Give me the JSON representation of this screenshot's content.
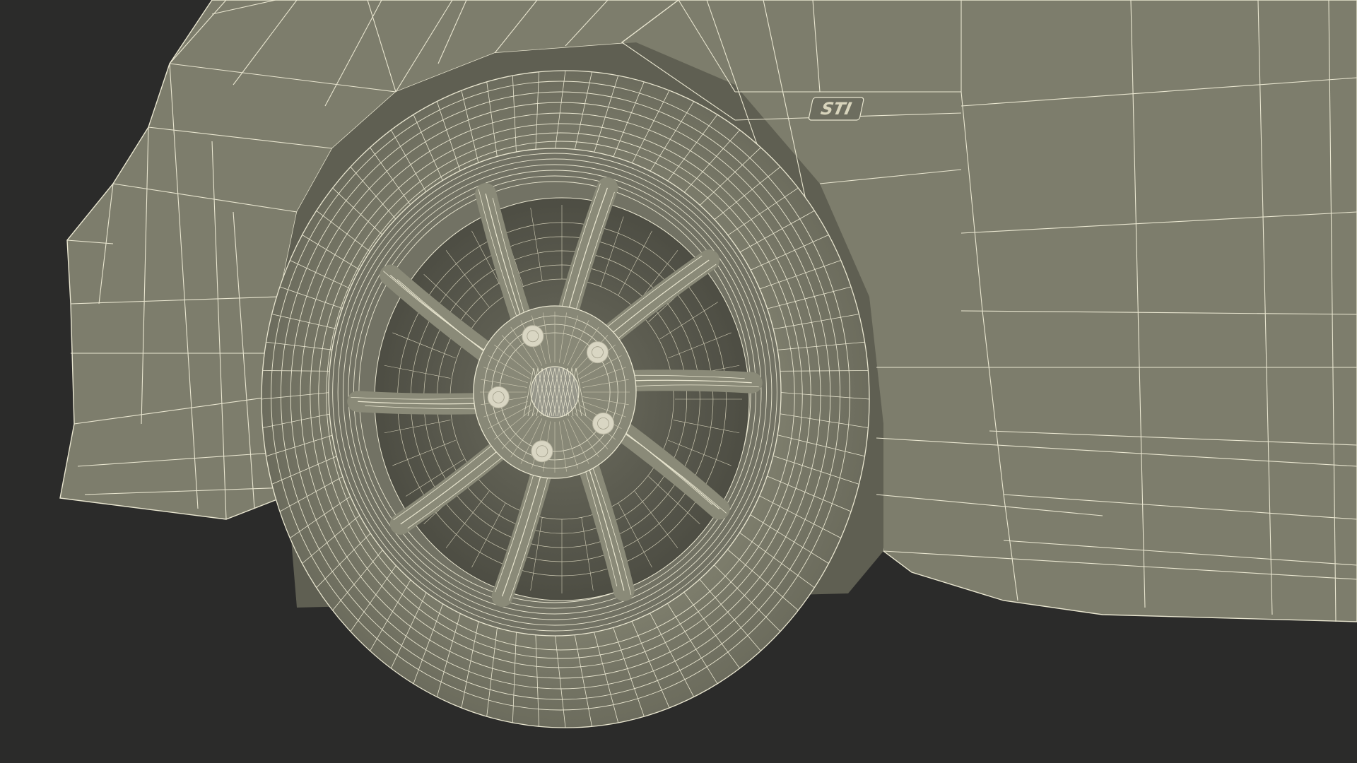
{
  "scene": {
    "subject": "car-front-wheel-wireframe",
    "badge_text": "STI",
    "lug_nut_count": 5,
    "spoke_count": 10
  },
  "colors": {
    "background": "#2b2b2a",
    "surface": "#7d7d6c",
    "surface_shadow": "#5f5f52",
    "surface_dark": "#4a4a40",
    "wire": "#e9e6d0",
    "wire_dim": "#cfcbb4"
  }
}
